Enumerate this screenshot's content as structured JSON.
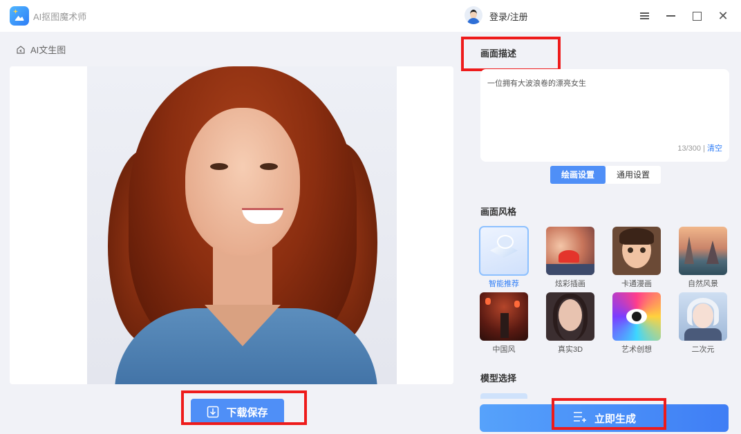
{
  "app": {
    "title": "AI抠图魔术师",
    "login_label": "登录/注册"
  },
  "breadcrumb": {
    "label": "AI文生图"
  },
  "actions": {
    "download_label": "下载保存",
    "generate_label": "立即生成"
  },
  "prompt": {
    "section_title": "画面描述",
    "text": "一位拥有大波浪卷的漂亮女生",
    "counter": "13/300 |",
    "clear_label": "清空"
  },
  "tabs": [
    {
      "label": "绘画设置",
      "active": true
    },
    {
      "label": "通用设置",
      "active": false
    }
  ],
  "styles": {
    "section_title": "画面风格",
    "items": [
      {
        "label": "智能推荐",
        "selected": true
      },
      {
        "label": "炫彩插画",
        "selected": false
      },
      {
        "label": "卡通漫画",
        "selected": false
      },
      {
        "label": "自然风景",
        "selected": false
      },
      {
        "label": "中国风",
        "selected": false
      },
      {
        "label": "真实3D",
        "selected": false
      },
      {
        "label": "艺术创想",
        "selected": false
      },
      {
        "label": "二次元",
        "selected": false
      }
    ]
  },
  "model": {
    "section_title": "模型选择"
  },
  "colors": {
    "accent": "#4f8ff7",
    "highlight_box": "#ee1b1b"
  }
}
